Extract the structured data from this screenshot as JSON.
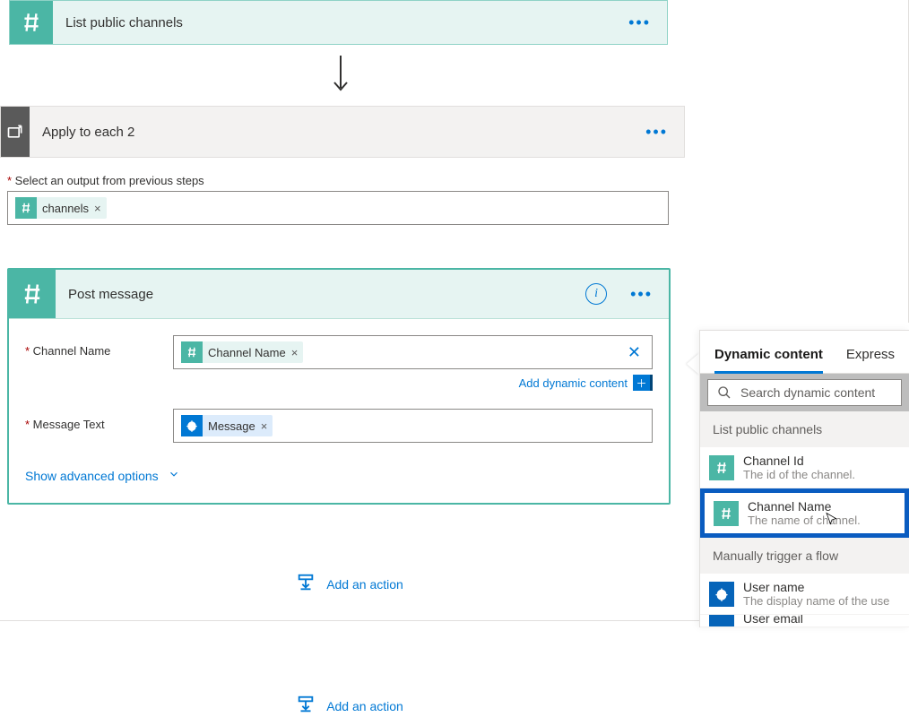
{
  "step1": {
    "title": "List public channels"
  },
  "applyEach": {
    "title": "Apply to each 2",
    "selectLabel": "Select an output from previous steps",
    "pill": "channels"
  },
  "post": {
    "title": "Post message",
    "channelNameLabel": "Channel Name",
    "channelNamePill": "Channel Name",
    "messageTextLabel": "Message Text",
    "messagePill": "Message",
    "addDynamic": "Add dynamic content",
    "showAdvanced": "Show advanced options"
  },
  "addAction": "Add an action",
  "dc": {
    "tab1": "Dynamic content",
    "tab2": "Express",
    "searchPlaceholder": "Search dynamic content",
    "section1": "List public channels",
    "items1": [
      {
        "name": "Channel Id",
        "desc": "The id of the channel."
      },
      {
        "name": "Channel Name",
        "desc": "The name of channel."
      }
    ],
    "section2": "Manually trigger a flow",
    "items2": [
      {
        "name": "User name",
        "desc": "The display name of the use"
      },
      {
        "name": "User email",
        "desc": ""
      }
    ]
  }
}
